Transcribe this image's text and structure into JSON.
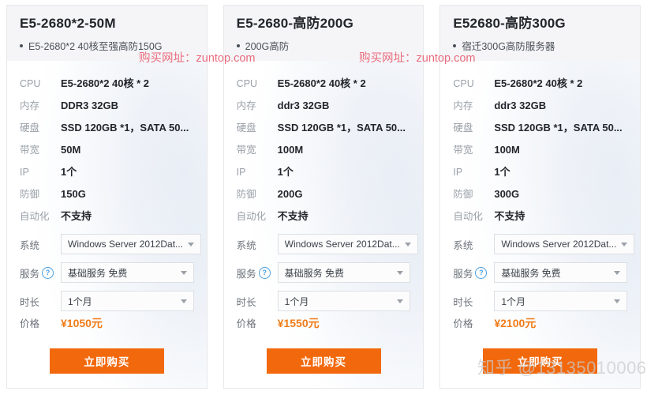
{
  "colors": {
    "accent_orange": "#f2690d",
    "price_orange": "#f07c18",
    "watermark_red": "#e8556a",
    "header_bg": "#f5f5f7",
    "label_gray": "#9aa0a8"
  },
  "spec_labels": {
    "cpu": "CPU",
    "memory": "内存",
    "disk": "硬盘",
    "bandwidth": "带宽",
    "ip": "IP",
    "defense": "防御",
    "automation": "自动化"
  },
  "option_labels": {
    "system": "系统",
    "service": "服务",
    "duration": "时长",
    "price": "价格",
    "help_icon": "?"
  },
  "buy_label": "立即购买",
  "watermarks": {
    "red_one": "购买网址：zuntop.com",
    "red_two": "购买网址：zuntop.com",
    "zhihu": "知乎 @13135010006"
  },
  "cards": [
    {
      "title": "E5-2680*2-50M",
      "subtitle": "E5-2680*2 40核至强高防150G",
      "cpu": "E5-2680*2 40核 * 2",
      "memory": "DDR3 32GB",
      "disk": "SSD 120GB *1，SATA 50...",
      "bandwidth": "50M",
      "ip": "1个",
      "defense": "150G",
      "automation": "不支持",
      "system": "Windows Server 2012Dat...",
      "service": "基础服务 免费",
      "duration": "1个月",
      "price": "¥1050元"
    },
    {
      "title": "E5-2680-高防200G",
      "subtitle": "200G高防",
      "cpu": "E5-2680*2 40核 * 2",
      "memory": "ddr3 32GB",
      "disk": "SSD 120GB *1，SATA 50...",
      "bandwidth": "100M",
      "ip": "1个",
      "defense": "200G",
      "automation": "不支持",
      "system": "Windows Server 2012Dat...",
      "service": "基础服务 免费",
      "duration": "1个月",
      "price": "¥1550元"
    },
    {
      "title": "E52680-高防300G",
      "subtitle": "宿迁300G高防服务器",
      "cpu": "E5-2680*2 40核 * 2",
      "memory": "ddr3 32GB",
      "disk": "SSD 120GB *1，SATA 50...",
      "bandwidth": "100M",
      "ip": "1个",
      "defense": "300G",
      "automation": "不支持",
      "system": "Windows Server 2012Dat...",
      "service": "基础服务 免费",
      "duration": "1个月",
      "price": "¥2100元"
    }
  ]
}
